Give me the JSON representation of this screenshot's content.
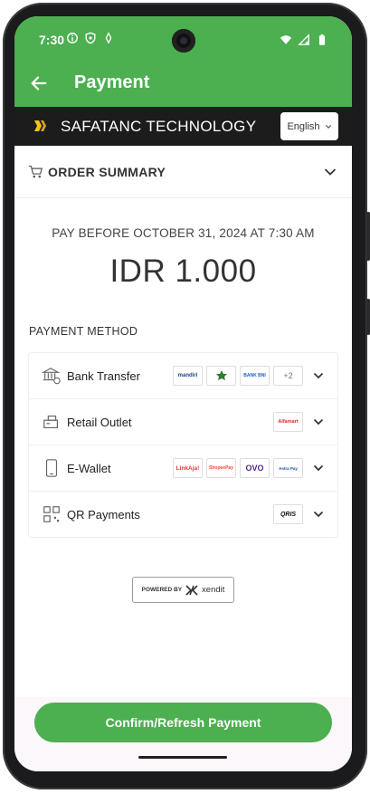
{
  "status_bar": {
    "time": "7:30"
  },
  "app_bar": {
    "title": "Payment"
  },
  "merchant": {
    "name": "SAFATANC TECHNOLOGY",
    "language": "English"
  },
  "order_summary": {
    "label": "ORDER SUMMARY"
  },
  "payment": {
    "due_text": "PAY BEFORE OCTOBER 31, 2024 AT 7:30 AM",
    "amount": "IDR 1.000"
  },
  "payment_method": {
    "title": "PAYMENT METHOD",
    "rows": [
      {
        "label": "Bank Transfer",
        "icon": "bank-icon",
        "logos": [
          "mandiri",
          "bri-icon",
          "BANK BNI"
        ],
        "more": "+2"
      },
      {
        "label": "Retail Outlet",
        "icon": "store-icon",
        "logos": [
          "Alfamart"
        ]
      },
      {
        "label": "E-Wallet",
        "icon": "phone-icon",
        "logos": [
          "LinkAja!",
          "ShopeePay",
          "OVO",
          "Astra Pay"
        ]
      },
      {
        "label": "QR Payments",
        "icon": "qr-icon",
        "logos": [
          "QRIS"
        ]
      }
    ]
  },
  "powered_by": {
    "label": "POWERED BY",
    "brand": "xendit"
  },
  "confirm_button": {
    "label": "Confirm/Refresh Payment"
  },
  "colors": {
    "primary": "#4caf50",
    "merchant_bar": "#1c1c1c",
    "text": "#333333"
  }
}
